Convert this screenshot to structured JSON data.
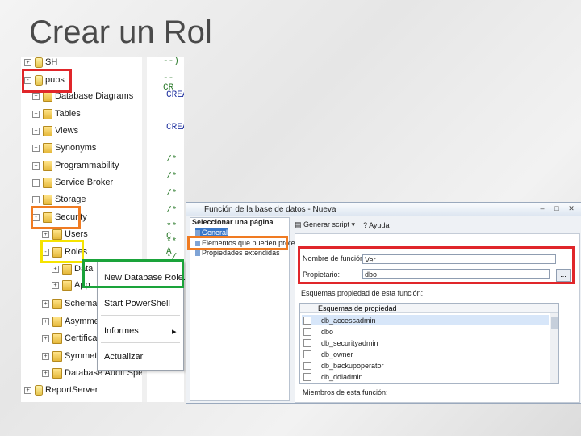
{
  "slide": {
    "title": "Crear un Rol"
  },
  "explorer": {
    "nodes": [
      "SH",
      "pubs",
      "Database Diagrams",
      "Tables",
      "Views",
      "Synonyms",
      "Programmability",
      "Service Broker",
      "Storage",
      "Security",
      "Users",
      "Roles",
      "Data",
      "App",
      "Schemas",
      "Asymme",
      "Certificat",
      "Symmet",
      "Database Audit Specificatio",
      "ReportServer"
    ]
  },
  "editor": {
    "lines": [
      "--)",
      "--CR",
      "CREA",
      "CREA",
      "/*",
      "/*",
      "/*",
      "/*",
      "** C",
      "** A",
      "*/",
      "/*"
    ]
  },
  "context_menu": {
    "items": [
      "New Database Role...",
      "Start PowerShell",
      "Informes",
      "Actualizar"
    ],
    "submenu_arrow": "▸"
  },
  "dialog": {
    "title": "Función de la base de datos - Nueva",
    "pages_header": "Seleccionar una página",
    "pages": [
      "General",
      "Elementos que pueden protege",
      "Propiedades extendidas"
    ],
    "toolbar": {
      "script": "Generar script",
      "help": "Ayuda"
    },
    "fields": {
      "name_label": "Nombre de función:",
      "name_value": "Ver",
      "owner_label": "Propietario:",
      "owner_value": "dbo",
      "browse": "..."
    },
    "schemas_section": "Esquemas propiedad de esta función:",
    "schemas_header": "Esquemas de propiedad",
    "schemas": [
      "db_accessadmin",
      "dbo",
      "db_securityadmin",
      "db_owner",
      "db_backupoperator",
      "db_ddladmin"
    ],
    "members_section": "Miembros de esta función:"
  },
  "highlight_colors": {
    "pubs": "#e0262a",
    "security": "#f07b22",
    "roles": "#f5e300",
    "new_role": "#1aa33a",
    "page": "#f07b22",
    "fields": "#e0262a"
  }
}
